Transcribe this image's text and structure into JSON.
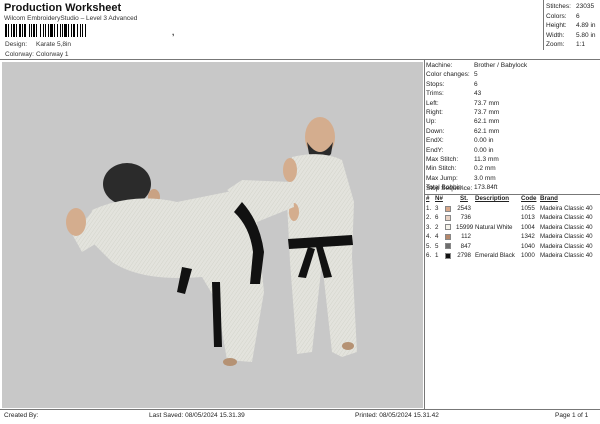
{
  "header": {
    "title": "Production Worksheet",
    "subtitle": "Wilcom EmbroideryStudio – Level 3 Advanced",
    "barcode_mark": ",",
    "design_label": "Design:",
    "design_value": "Karate 5,8in",
    "colorway_label": "Colorway:",
    "colorway_value": "Colorway 1"
  },
  "summary": [
    {
      "label": "Stitches:",
      "value": "23035"
    },
    {
      "label": "Colors:",
      "value": "6"
    },
    {
      "label": "Height:",
      "value": "4.89 in"
    },
    {
      "label": "Width:",
      "value": "5.80 in"
    },
    {
      "label": "Zoom:",
      "value": "1:1"
    }
  ],
  "details": [
    {
      "label": "Machine:",
      "value": "Brother / Babylock"
    },
    {
      "label": "Color changes:",
      "value": "5"
    },
    {
      "label": "Stops:",
      "value": "6"
    },
    {
      "label": "Trims:",
      "value": "43"
    },
    {
      "label": "Left:",
      "value": "73.7 mm"
    },
    {
      "label": "Right:",
      "value": "73.7 mm"
    },
    {
      "label": "Up:",
      "value": "62.1 mm"
    },
    {
      "label": "Down:",
      "value": "62.1 mm"
    },
    {
      "label": "EndX:",
      "value": "0.00 in"
    },
    {
      "label": "EndY:",
      "value": "0.00 in"
    },
    {
      "label": "Max Stitch:",
      "value": "11.3 mm"
    },
    {
      "label": "Min Stitch:",
      "value": "0.2 mm"
    },
    {
      "label": "Max Jump:",
      "value": "3.0 mm"
    },
    {
      "label": "Total Bobbin:",
      "value": "173.84ft"
    }
  ],
  "stop_sequence": {
    "title": "Stop Sequence:",
    "columns": {
      "num": "#",
      "n": "N#",
      "st": "St.",
      "desc": "Description",
      "code": "Code",
      "brand": "Brand"
    },
    "rows": [
      {
        "num": "1.",
        "n": "3",
        "color": "#d9a98b",
        "st": "2543",
        "desc": "",
        "code": "1055",
        "brand": "Madeira Classic 40"
      },
      {
        "num": "2.",
        "n": "6",
        "color": "#e8d2c4",
        "st": "736",
        "desc": "",
        "code": "1013",
        "brand": "Madeira Classic 40"
      },
      {
        "num": "3.",
        "n": "2",
        "color": "#f4f2ea",
        "st": "15999",
        "desc": "Natural White",
        "code": "1004",
        "brand": "Madeira Classic 40"
      },
      {
        "num": "4.",
        "n": "4",
        "color": "#b5876a",
        "st": "112",
        "desc": "",
        "code": "1342",
        "brand": "Madeira Classic 40"
      },
      {
        "num": "5.",
        "n": "5",
        "color": "#6d6d6d",
        "st": "847",
        "desc": "",
        "code": "1040",
        "brand": "Madeira Classic 40"
      },
      {
        "num": "6.",
        "n": "1",
        "color": "#111111",
        "st": "2798",
        "desc": "Emerald Black",
        "code": "1000",
        "brand": "Madeira Classic 40"
      }
    ]
  },
  "footer": {
    "created_by": "Created By:",
    "last_saved": "Last Saved: 08/05/2024 15.31.39",
    "printed": "Printed: 08/05/2024 15.31.42",
    "page": "Page 1 of 1"
  }
}
